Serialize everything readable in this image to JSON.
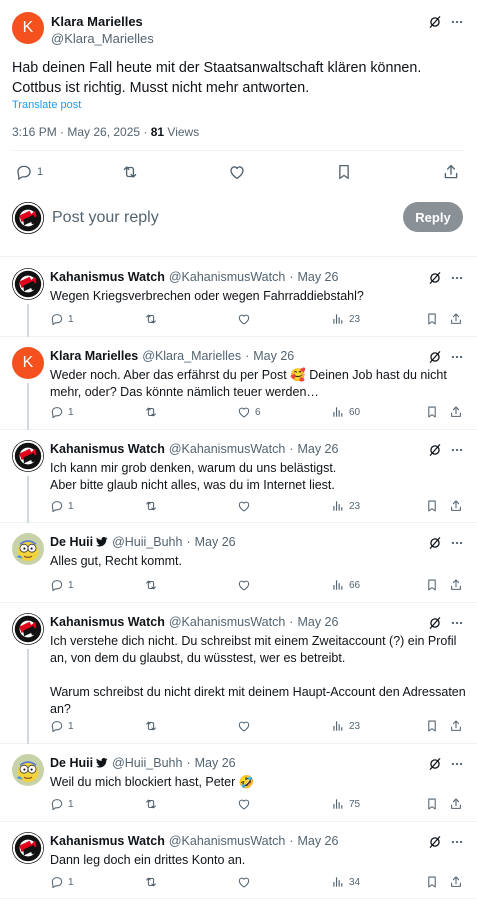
{
  "main_post": {
    "author_name": "Klara Marielles",
    "author_handle": "@Klara_Marielles",
    "avatar_letter": "K",
    "text": "Hab deinen Fall heute mit der Staatsanwaltschaft klären können. Cottbus ist richtig. Musst nicht mehr antworten.",
    "translate_label": "Translate post",
    "time": "3:16 PM · May 26, 2025 · ",
    "views_count": "81",
    "views_label": " Views",
    "reply_count": "1"
  },
  "reply_box": {
    "placeholder": "Post your reply",
    "button_label": "Reply"
  },
  "replies": [
    {
      "name": "Kahanismus Watch",
      "handle": "@KahanismusWatch",
      "date": "May 26",
      "text": "Wegen Kriegsverbrechen oder wegen Fahrraddiebstahl?",
      "replies": "1",
      "likes": "",
      "views": "23"
    },
    {
      "name": "Klara Marielles",
      "handle": "@Klara_Marielles",
      "date": "May 26",
      "text": "Weder noch. Aber das erfährst du per Post 🥰 Deinen Job hast du nicht mehr, oder? Das könnte nämlich teuer werden…",
      "replies": "1",
      "likes": "6",
      "views": "60"
    },
    {
      "name": "Kahanismus Watch",
      "handle": "@KahanismusWatch",
      "date": "May 26",
      "text": "Ich kann mir grob denken, warum du uns belästigst.\nAber bitte glaub nicht alles, was du im Internet liest.",
      "replies": "1",
      "likes": "",
      "views": "23"
    },
    {
      "name": "De Huii",
      "handle": "@Huii_Buhh",
      "date": "May 26",
      "text": "Alles gut, Recht kommt.",
      "replies": "1",
      "likes": "",
      "views": "66"
    },
    {
      "name": "Kahanismus Watch",
      "handle": "@KahanismusWatch",
      "date": "May 26",
      "text": "Ich verstehe dich nicht. Du schreibst mit einem Zweitaccount (?) ein Profil an, von dem du glaubst, du wüsstest, wer es betreibt.\n\nWarum schreibst du nicht direkt mit deinem Haupt-Account den Adressaten an?",
      "replies": "1",
      "likes": "",
      "views": "23"
    },
    {
      "name": "De Huii",
      "handle": "@Huii_Buhh",
      "date": "May 26",
      "text": "Weil du mich blockiert hast, Peter 🤣",
      "replies": "1",
      "likes": "",
      "views": "75"
    },
    {
      "name": "Kahanismus Watch",
      "handle": "@KahanismusWatch",
      "date": "May 26",
      "text": "Dann leg doch ein drittes Konto an.",
      "replies": "1",
      "likes": "",
      "views": "34"
    }
  ],
  "colors": {
    "link": "#1d9bf0",
    "secondary_text": "#536471",
    "avatar_orange": "#f4511e",
    "antifa_red": "#e2001a",
    "reply_button": "#8a9196"
  },
  "icons": [
    "reply-icon",
    "retweet-icon",
    "like-icon",
    "bookmark-icon",
    "share-icon",
    "views-icon",
    "grok-icon",
    "more-icon",
    "verified-bird-icon"
  ]
}
